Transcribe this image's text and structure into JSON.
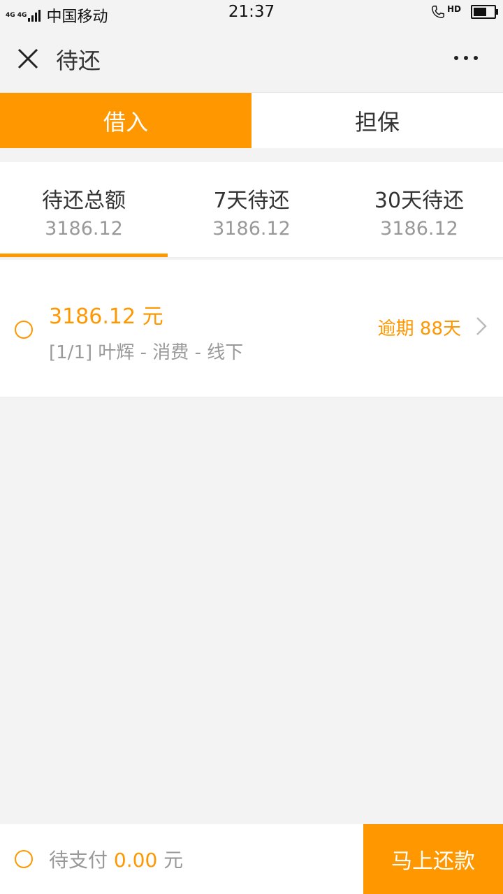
{
  "status_bar": {
    "network": "4G 4G",
    "carrier": "中国移动",
    "time": "21:37",
    "hd": "HD"
  },
  "header": {
    "title": "待还"
  },
  "tabs": [
    {
      "label": "借入",
      "active": true
    },
    {
      "label": "担保",
      "active": false
    }
  ],
  "summary": [
    {
      "label": "待还总额",
      "value": "3186.12"
    },
    {
      "label": "7天待还",
      "value": "3186.12"
    },
    {
      "label": "30天待还",
      "value": "3186.12"
    }
  ],
  "items": [
    {
      "amount": "3186.12 元",
      "description": "[1/1] 叶辉 - 消费 - 线下",
      "overdue": "逾期 88天"
    }
  ],
  "bottom": {
    "pay_prefix": "待支付",
    "pay_amount": "0.00",
    "pay_unit": "元",
    "button_label": "马上还款"
  },
  "colors": {
    "accent": "#ff9800",
    "background": "#f3f3f3"
  }
}
